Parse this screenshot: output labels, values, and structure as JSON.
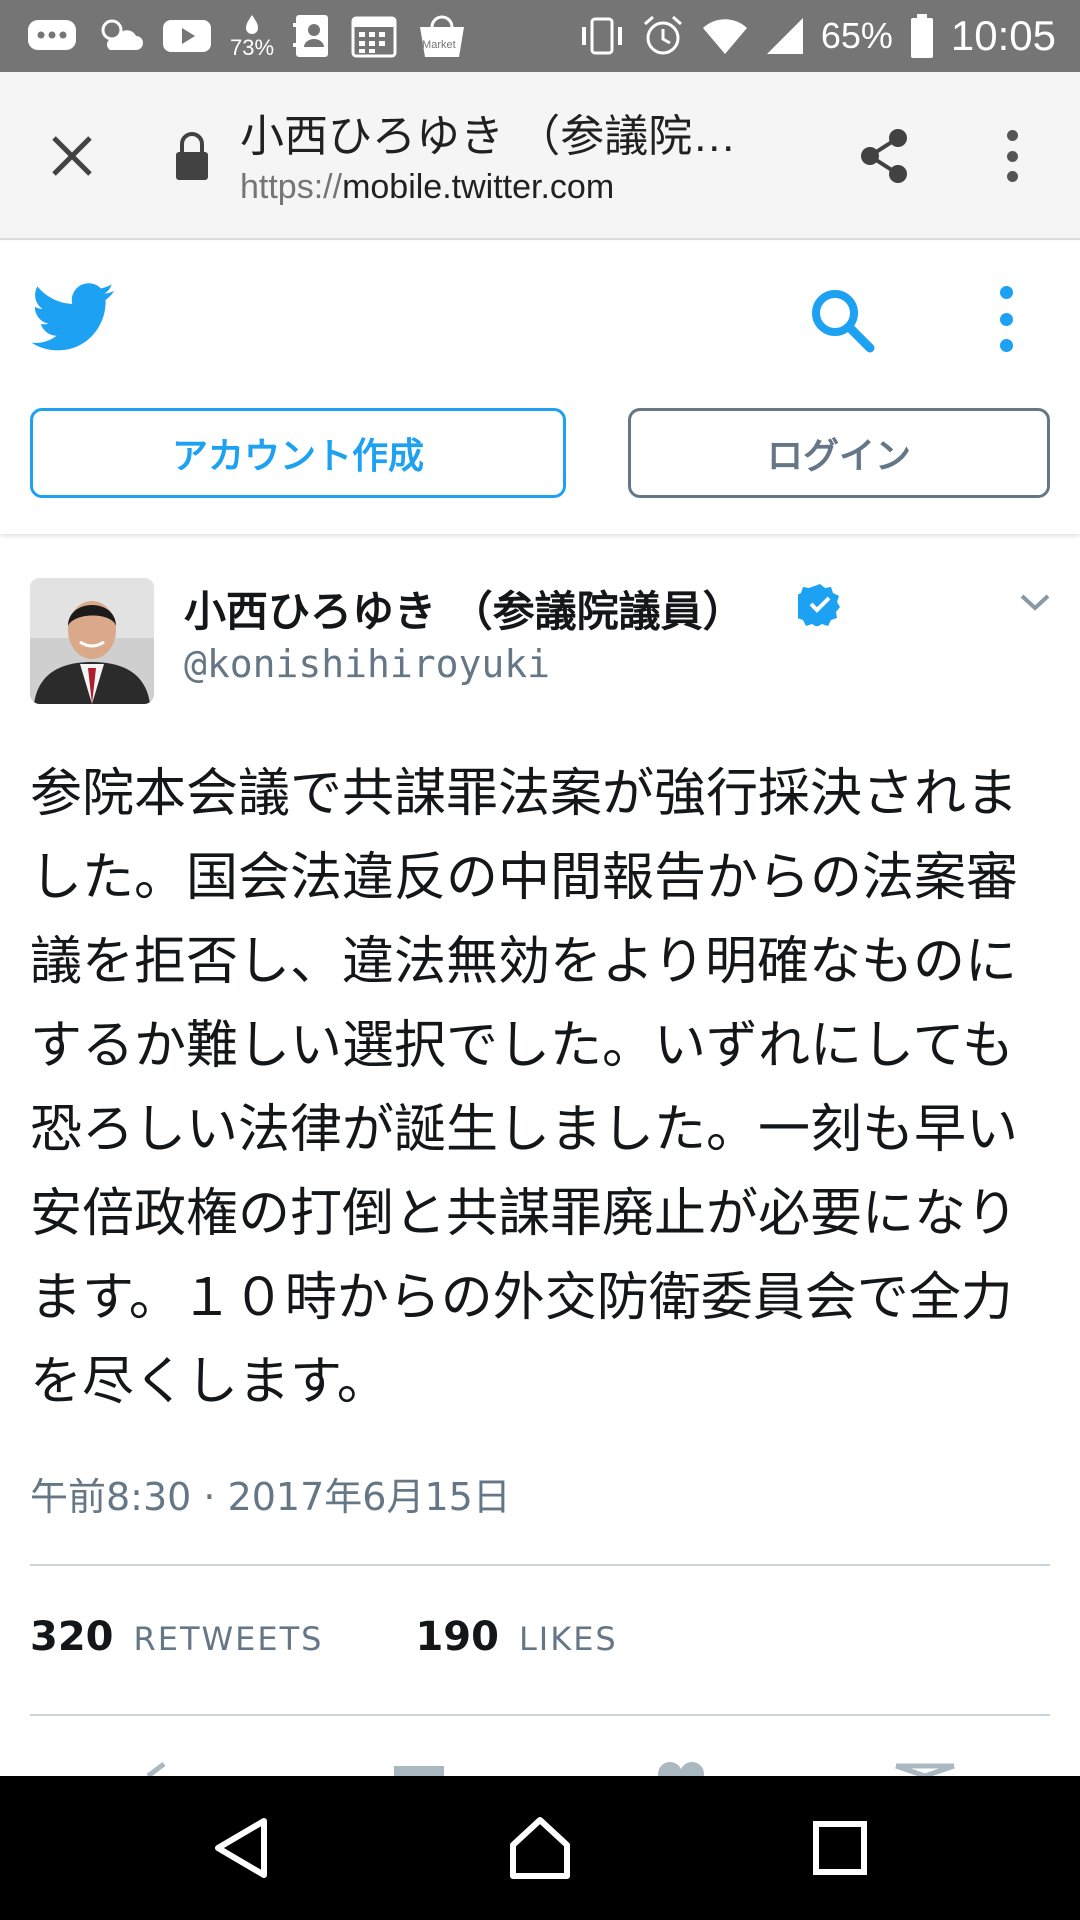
{
  "status_bar": {
    "temperature": "73",
    "temperature_unit": "%",
    "battery_percent": "65%",
    "time": "10:05",
    "icons": [
      "chat-icon",
      "weather-icon",
      "youtube-icon",
      "temperature-icon",
      "contacts-icon",
      "calendar-icon",
      "market-icon",
      "vibrate-icon",
      "alarm-icon",
      "wifi-icon",
      "signal-icon",
      "battery-icon"
    ],
    "market_label": "Market"
  },
  "browser": {
    "title": "小西ひろゆき （参議院…",
    "url_scheme": "https://",
    "url_host": "mobile.twitter.com"
  },
  "twitter_header": {
    "signup_label": "アカウント作成",
    "login_label": "ログイン",
    "brand_color": "#1da1f2"
  },
  "tweet": {
    "display_name": "小西ひろゆき （参議院議員）",
    "handle": "@konishihiroyuki",
    "verified": true,
    "text": "参院本会議で共謀罪法案が強行採決されました。国会法違反の中間報告からの法案審議を拒否し、違法無効をより明確なものにするか難しい選択でした。いずれにしても恐ろしい法律が誕生しました。一刻も早い安倍政権の打倒と共謀罪廃止が必要になります。１０時からの外交防衛委員会で全力を尽くします。",
    "timestamp": "午前8:30 · 2017年6月15日",
    "retweets_count": "320",
    "retweets_label": "RETWEETS",
    "likes_count": "190",
    "likes_label": "LIKES"
  },
  "colors": {
    "status_bar": "#757575",
    "text_primary": "#14171a",
    "text_secondary": "#657786",
    "divider": "#c9d3dc"
  }
}
